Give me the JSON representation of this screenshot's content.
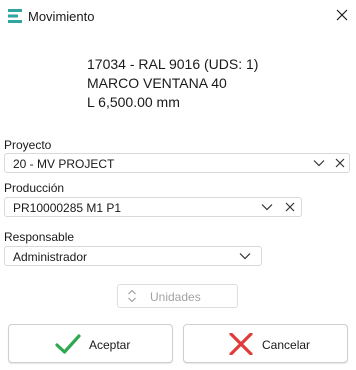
{
  "window": {
    "title": "Movimiento"
  },
  "item": {
    "line1": "17034   -   RAL 9016 (UDS: 1)",
    "line2": "MARCO VENTANA 40",
    "line3": "L 6,500.00 mm"
  },
  "proyecto": {
    "label": "Proyecto",
    "value": "20  -  MV PROJECT"
  },
  "produccion": {
    "label": "Producción",
    "value": "PR10000285 M1 P1"
  },
  "responsable": {
    "label": "Responsable",
    "value": "Administrador"
  },
  "unidades": {
    "placeholder": "Unidades"
  },
  "buttons": {
    "accept": "Aceptar",
    "cancel": "Cancelar"
  },
  "colors": {
    "accept_check": "#2fa84f",
    "cancel_x": "#e23b3b",
    "app_icon": "#2ea6a0"
  }
}
